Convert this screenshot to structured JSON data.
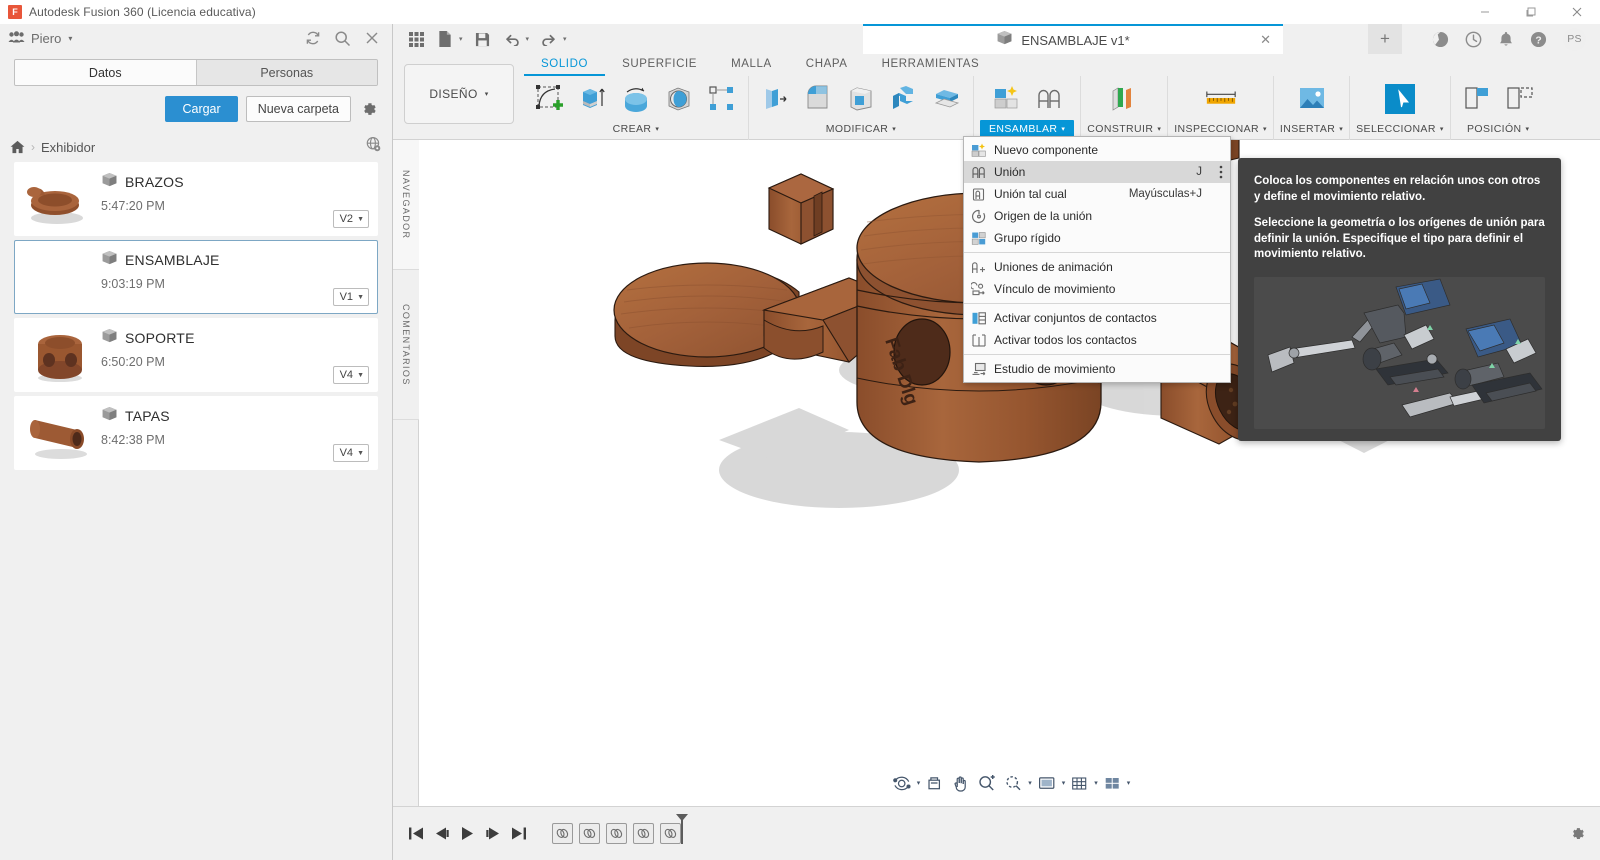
{
  "window": {
    "app_title": "Autodesk Fusion 360 (Licencia educativa)",
    "logo_letter": "F",
    "minimize": "—",
    "maximize": "❐",
    "close": "✕"
  },
  "left_panel": {
    "hub_name": "Piero",
    "hub_caret": "▾",
    "icons": {
      "refresh": "refresh-icon",
      "search": "search-icon",
      "close": "close-icon"
    },
    "tabs": [
      {
        "label": "Datos",
        "active": true
      },
      {
        "label": "Personas",
        "active": false
      }
    ],
    "buttons": {
      "upload": "Cargar",
      "new_folder": "Nueva carpeta",
      "settings_icon": "gear-icon"
    },
    "breadcrumb": {
      "home_icon": "home-icon",
      "separator": "›",
      "current": "Exhibidor",
      "right_icon": "globe-visibility-icon"
    },
    "files": [
      {
        "name": "BRAZOS",
        "time": "5:47:20 PM",
        "version": "V2",
        "selected": false
      },
      {
        "name": "ENSAMBLAJE",
        "time": "9:03:19 PM",
        "version": "V1",
        "selected": true
      },
      {
        "name": "SOPORTE",
        "time": "6:50:20 PM",
        "version": "V4",
        "selected": false
      },
      {
        "name": "TAPAS",
        "time": "8:42:38 PM",
        "version": "V4",
        "selected": false
      }
    ]
  },
  "quick_access": {
    "icons": [
      "grid-icon",
      "file-new-icon",
      "save-icon",
      "undo-icon",
      "redo-icon"
    ],
    "caret": "▾"
  },
  "document_tab": {
    "label": "ENSAMBLAJE v1*",
    "cube_icon": "component-cube-icon",
    "close": "✕",
    "new_tab": "+"
  },
  "top_right": {
    "icons": [
      "extensions-icon",
      "job-status-icon",
      "notifications-bell-icon",
      "help-icon"
    ],
    "avatar_initials": "PS"
  },
  "ribbon": {
    "workspace": {
      "label": "DISEÑO",
      "caret": "▾"
    },
    "tabs": [
      {
        "label": "SOLIDO",
        "active": true
      },
      {
        "label": "SUPERFICIE",
        "active": false
      },
      {
        "label": "MALLA",
        "active": false
      },
      {
        "label": "CHAPA",
        "active": false
      },
      {
        "label": "HERRAMIENTAS",
        "active": false
      }
    ],
    "groups": [
      {
        "label": "CREAR",
        "caret": "▾",
        "highlighted": false,
        "icon_count": 5,
        "icons": [
          "create-sketch-icon",
          "extrude-icon",
          "revolve-icon",
          "sphere-icon",
          "pattern-icon"
        ]
      },
      {
        "label": "MODIFICAR",
        "caret": "▾",
        "highlighted": false,
        "icon_count": 5,
        "icons": [
          "press-pull-icon",
          "fillet-icon",
          "shell-icon",
          "combine-icon",
          "offset-face-icon"
        ]
      },
      {
        "label": "ENSAMBLAR",
        "caret": "▾",
        "highlighted": true,
        "icon_count": 2,
        "icons": [
          "new-component-icon",
          "joint-icon"
        ]
      },
      {
        "label": "CONSTRUIR",
        "caret": "▾",
        "highlighted": false,
        "icon_count": 1,
        "icons": [
          "construction-plane-icon"
        ]
      },
      {
        "label": "INSPECCIONAR",
        "caret": "▾",
        "highlighted": false,
        "icon_count": 1,
        "icons": [
          "measure-ruler-icon"
        ]
      },
      {
        "label": "INSERTAR",
        "caret": "▾",
        "highlighted": false,
        "icon_count": 1,
        "icons": [
          "insert-image-icon"
        ]
      },
      {
        "label": "SELECCIONAR",
        "caret": "▾",
        "highlighted": false,
        "icon_count": 1,
        "icons": [
          "select-cursor-icon"
        ]
      },
      {
        "label": "POSICIÓN",
        "caret": "▾",
        "highlighted": false,
        "icon_count": 2,
        "icons": [
          "dock-left-icon",
          "dock-right-icon"
        ]
      }
    ]
  },
  "assemble_menu": {
    "items": [
      {
        "label": "Nuevo componente",
        "shortcut": "",
        "icon": "new-component-icon",
        "active": false,
        "sep_after": false
      },
      {
        "label": "Unión",
        "shortcut": "J",
        "icon": "joint-icon",
        "active": true,
        "sep_after": false,
        "overflow": "⋮"
      },
      {
        "label": "Unión tal cual",
        "shortcut": "Mayúsculas+J",
        "icon": "as-built-joint-icon",
        "active": false,
        "sep_after": false
      },
      {
        "label": "Origen de la unión",
        "shortcut": "",
        "icon": "joint-origin-icon",
        "active": false,
        "sep_after": false
      },
      {
        "label": "Grupo rígido",
        "shortcut": "",
        "icon": "rigid-group-icon",
        "active": false,
        "sep_after": true
      },
      {
        "label": "Uniones de animación",
        "shortcut": "",
        "icon": "animate-joints-icon",
        "active": false,
        "sep_after": false
      },
      {
        "label": "Vínculo de movimiento",
        "shortcut": "",
        "icon": "motion-link-icon",
        "active": false,
        "sep_after": true
      },
      {
        "label": "Activar conjuntos de contactos",
        "shortcut": "",
        "icon": "enable-contact-sets-icon",
        "active": false,
        "sep_after": false
      },
      {
        "label": "Activar todos los contactos",
        "shortcut": "",
        "icon": "enable-all-contacts-icon",
        "active": false,
        "sep_after": true
      },
      {
        "label": "Estudio de movimiento",
        "shortcut": "",
        "icon": "motion-study-icon",
        "active": false,
        "sep_after": false
      }
    ]
  },
  "tooltip": {
    "paragraph_1": "Coloca los componentes en relación unos con otros y define el movimiento relativo.",
    "paragraph_2": "Seleccione la geometría o los orígenes de unión para definir la unión. Especifique el tipo para definir el movimiento relativo.",
    "illustration": "joint-clamp-assembly-illustration"
  },
  "viewport": {
    "side_tabs": [
      {
        "label": "NAVEGADOR",
        "icon": "expand-panel-icon"
      },
      {
        "label": "COMENTARIOS",
        "icon": ""
      }
    ],
    "model_engraving": "Fab Dlg",
    "navigation_bar": [
      {
        "icon": "orbit-icon",
        "caret": "▾"
      },
      {
        "icon": "look-at-icon",
        "caret": ""
      },
      {
        "icon": "pan-hand-icon",
        "caret": ""
      },
      {
        "icon": "zoom-plus-icon",
        "caret": ""
      },
      {
        "icon": "zoom-window-icon",
        "caret": "▾"
      },
      {
        "icon": "display-settings-icon",
        "caret": "▾"
      },
      {
        "icon": "grid-snap-icon",
        "caret": "▾"
      },
      {
        "icon": "viewports-layout-icon",
        "caret": "▾"
      }
    ]
  },
  "timeline": {
    "playback": [
      {
        "icon": "go-to-beginning-icon"
      },
      {
        "icon": "step-back-icon"
      },
      {
        "icon": "play-icon"
      },
      {
        "icon": "step-forward-icon"
      },
      {
        "icon": "go-to-end-icon"
      }
    ],
    "features": [
      {
        "icon": "joint-feature-icon"
      },
      {
        "icon": "joint-feature-icon"
      },
      {
        "icon": "joint-feature-icon"
      },
      {
        "icon": "joint-feature-icon"
      },
      {
        "icon": "joint-feature-icon"
      }
    ],
    "marker": "timeline-marker",
    "settings_icon": "gear-icon"
  },
  "colors": {
    "accent_blue": "#0696d7",
    "button_blue": "#2b8fd1",
    "tooltip_bg": "#414141",
    "panel_bg": "#f0f0f0",
    "canvas_bg": "#ffffff",
    "wood_brown": "#9a5a32"
  }
}
